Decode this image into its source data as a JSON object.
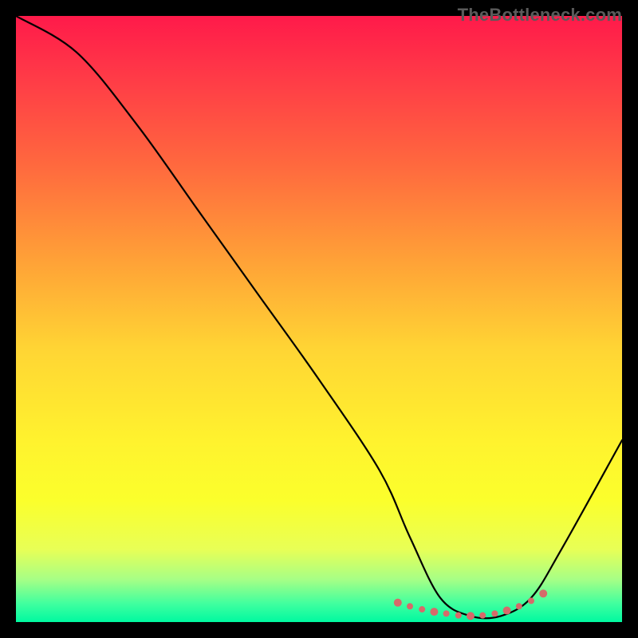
{
  "watermark": "TheBottleneck.com",
  "chart_data": {
    "type": "line",
    "title": "",
    "xlabel": "",
    "ylabel": "",
    "xlim": [
      0,
      100
    ],
    "ylim": [
      0,
      100
    ],
    "series": [
      {
        "name": "curve",
        "x": [
          0,
          10,
          20,
          30,
          40,
          50,
          60,
          65,
          70,
          75,
          80,
          85,
          90,
          100
        ],
        "values": [
          100,
          94,
          82,
          68,
          54,
          40,
          25,
          14,
          4,
          1,
          1,
          4,
          12,
          30
        ]
      }
    ],
    "markers": {
      "name": "bottom-dots",
      "color": "#d66a6a",
      "points_x": [
        63,
        65,
        67,
        69,
        71,
        73,
        75,
        77,
        79,
        81,
        83,
        85,
        87
      ],
      "points_y": [
        3.2,
        2.6,
        2.1,
        1.7,
        1.4,
        1.1,
        1.0,
        1.1,
        1.4,
        1.9,
        2.6,
        3.5,
        4.7
      ]
    }
  }
}
